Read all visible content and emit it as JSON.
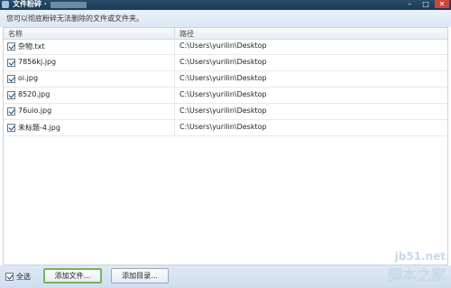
{
  "window": {
    "title": "文件粉碎 ·",
    "min_glyph": "–",
    "max_glyph": "□",
    "close_glyph": "✕"
  },
  "info": {
    "text": "您可以彻底粉碎无法删除的文件或文件夹。"
  },
  "table": {
    "columns": {
      "name": "名称",
      "path": "路径"
    },
    "rows": [
      {
        "name": "杂物.txt",
        "path": "C:\\Users\\yurilin\\Desktop",
        "checked": true
      },
      {
        "name": "7856kj.jpg",
        "path": "C:\\Users\\yurilin\\Desktop",
        "checked": true
      },
      {
        "name": "oi.jpg",
        "path": "C:\\Users\\yurilin\\Desktop",
        "checked": true
      },
      {
        "name": "8520.jpg",
        "path": "C:\\Users\\yurilin\\Desktop",
        "checked": true
      },
      {
        "name": "76uio.jpg",
        "path": "C:\\Users\\yurilin\\Desktop",
        "checked": true
      },
      {
        "name": "未标题-4.jpg",
        "path": "C:\\Users\\yurilin\\Desktop",
        "checked": true
      }
    ]
  },
  "footer": {
    "select_all_label": "全选",
    "select_all_checked": true,
    "add_file_label": "添加文件...",
    "add_dir_label": "添加目录..."
  },
  "watermark": {
    "url": "jb51.net",
    "name": "脚本之家"
  },
  "colors": {
    "titlebar": "#1d3954",
    "accent_button_border": "#79b35a",
    "close_button": "#c9483a"
  }
}
